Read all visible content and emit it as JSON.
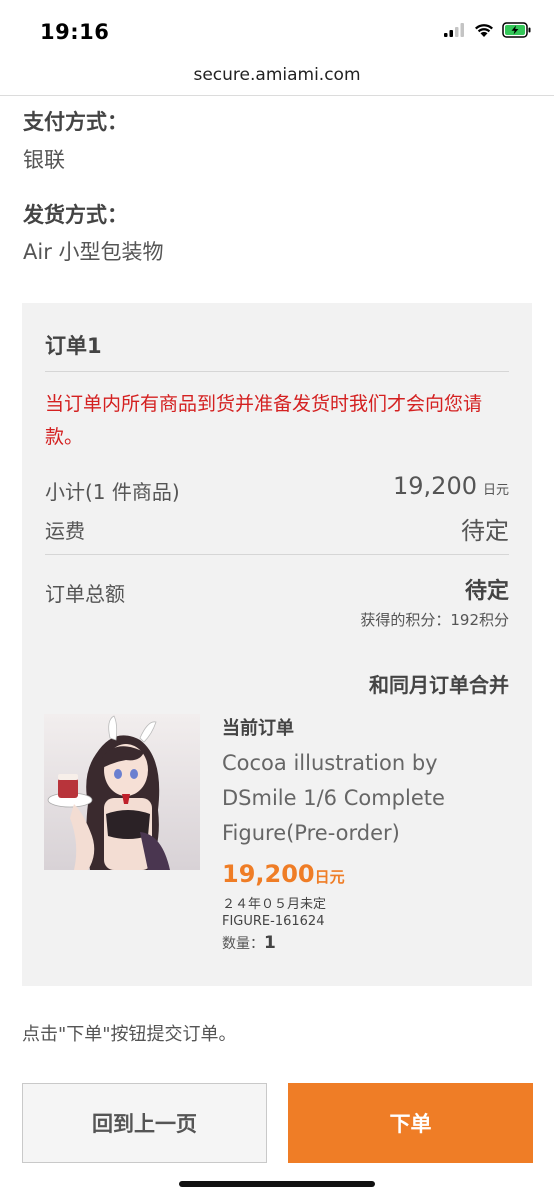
{
  "status_bar": {
    "time": "19:16"
  },
  "browser": {
    "url": "secure.amiami.com"
  },
  "payment": {
    "label": "支付方式：",
    "value": "银联"
  },
  "shipping": {
    "label": "发货方式：",
    "value": "Air 小型包装物"
  },
  "order": {
    "title": "订单1",
    "notice": "当订单内所有商品到货并准备发货时我们才会向您请款。",
    "subtotal_label": "小计(1 件商品)",
    "subtotal_value": "19,200",
    "subtotal_unit": "日元",
    "shipping_fee_label": "运费",
    "shipping_fee_value": "待定",
    "total_label": "订单总额",
    "total_value": "待定",
    "points": "获得的积分：192积分",
    "merge_label": "和同月订单合并"
  },
  "product": {
    "tag": "当前订单",
    "name": "Cocoa illustration by DSmile 1/6 Complete Figure(Pre-order)",
    "price": "19,200",
    "price_unit": "日元",
    "release": "２４年０５月未定",
    "sku": "FIGURE-161624",
    "qty_label": "数量：",
    "qty_value": "1"
  },
  "instruction": "点击\"下单\"按钮提交订单。",
  "buttons": {
    "back": "回到上一页",
    "submit": "下单"
  },
  "colors": {
    "accent": "#ef7d26",
    "notice": "#d42121",
    "box_bg": "#f2f2f2"
  },
  "icons": [
    "signal-icon",
    "wifi-icon",
    "battery-charging-icon"
  ]
}
